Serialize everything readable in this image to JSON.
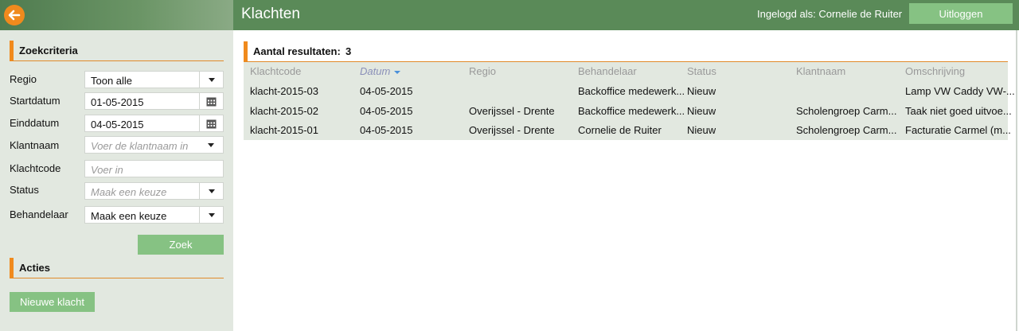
{
  "app": {
    "title": "Klachten",
    "login_label": "Ingelogd als:",
    "login_user": "Cornelie de Ruiter",
    "logout_label": "Uitloggen"
  },
  "sidebar": {
    "search_header": "Zoekcriteria",
    "fields": {
      "regio": {
        "label": "Regio",
        "value": "Toon alle"
      },
      "startdatum": {
        "label": "Startdatum",
        "value": "01-05-2015"
      },
      "einddatum": {
        "label": "Einddatum",
        "value": "04-05-2015"
      },
      "klantnaam": {
        "label": "Klantnaam",
        "placeholder": "Voer de klantnaam in"
      },
      "klachtcode": {
        "label": "Klachtcode",
        "placeholder": "Voer in"
      },
      "status": {
        "label": "Status",
        "placeholder": "Maak een keuze"
      },
      "behandelaar": {
        "label": "Behandelaar",
        "value": "Maak een keuze"
      }
    },
    "search_button": "Zoek",
    "actions_header": "Acties",
    "new_complaint_button": "Nieuwe klacht"
  },
  "results": {
    "label": "Aantal resultaten:",
    "count": "3",
    "columns": [
      "Klachtcode",
      "Datum",
      "Regio",
      "Behandelaar",
      "Status",
      "Klantnaam",
      "Omschrijving"
    ],
    "sorted_column": "Datum",
    "rows": [
      [
        "klacht-2015-03",
        "04-05-2015",
        "",
        "Backoffice medewerk...",
        "Nieuw",
        "",
        "Lamp VW Caddy VW-..."
      ],
      [
        "klacht-2015-02",
        "04-05-2015",
        "Overijssel - Drente",
        "Backoffice medewerk...",
        "Nieuw",
        "Scholengroep Carm...",
        "Taak niet goed uitvoe..."
      ],
      [
        "klacht-2015-01",
        "04-05-2015",
        "Overijssel - Drente",
        "Cornelie de Ruiter",
        "Nieuw",
        "Scholengroep Carm...",
        "Facturatie Carmel (m..."
      ]
    ]
  },
  "colors": {
    "topbar": "#5a8a58",
    "accent": "#f08a1d",
    "button": "#86c283",
    "sidebar_bg": "#e2e8e0"
  },
  "icons": {
    "back": "arrow-left-icon",
    "calendar": "calendar-icon",
    "dropdown": "chevron-down-icon",
    "sort": "sort-down-icon"
  }
}
